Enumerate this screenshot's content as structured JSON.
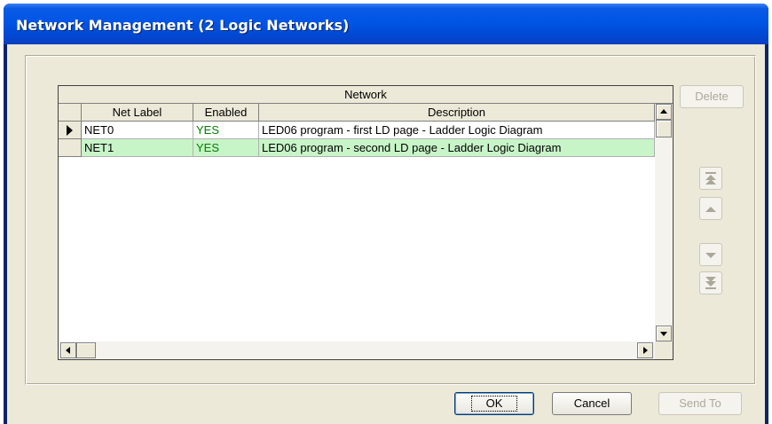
{
  "window": {
    "title": "Network Management (2 Logic Networks)"
  },
  "grid": {
    "caption": "Network",
    "columns": [
      "Net Label",
      "Enabled",
      "Description"
    ],
    "rows": [
      {
        "label": "NET0",
        "enabled": "YES",
        "description": "LED06 program - first LD page - Ladder Logic Diagram",
        "current": true,
        "selected": false
      },
      {
        "label": "NET1",
        "enabled": "YES",
        "description": "LED06 program - second LD page - Ladder Logic Diagram",
        "current": false,
        "selected": true
      }
    ]
  },
  "buttons": {
    "delete": "Delete",
    "ok": "OK",
    "cancel": "Cancel",
    "send_to": "Send To"
  },
  "nav_buttons": [
    "move-to-top",
    "move-up",
    "move-down",
    "move-to-bottom"
  ],
  "colors": {
    "titlebar": "#0055e5",
    "selected_row": "#c8f5c8",
    "enabled_text": "#008000",
    "dialog_bg": "#ece9d8"
  }
}
